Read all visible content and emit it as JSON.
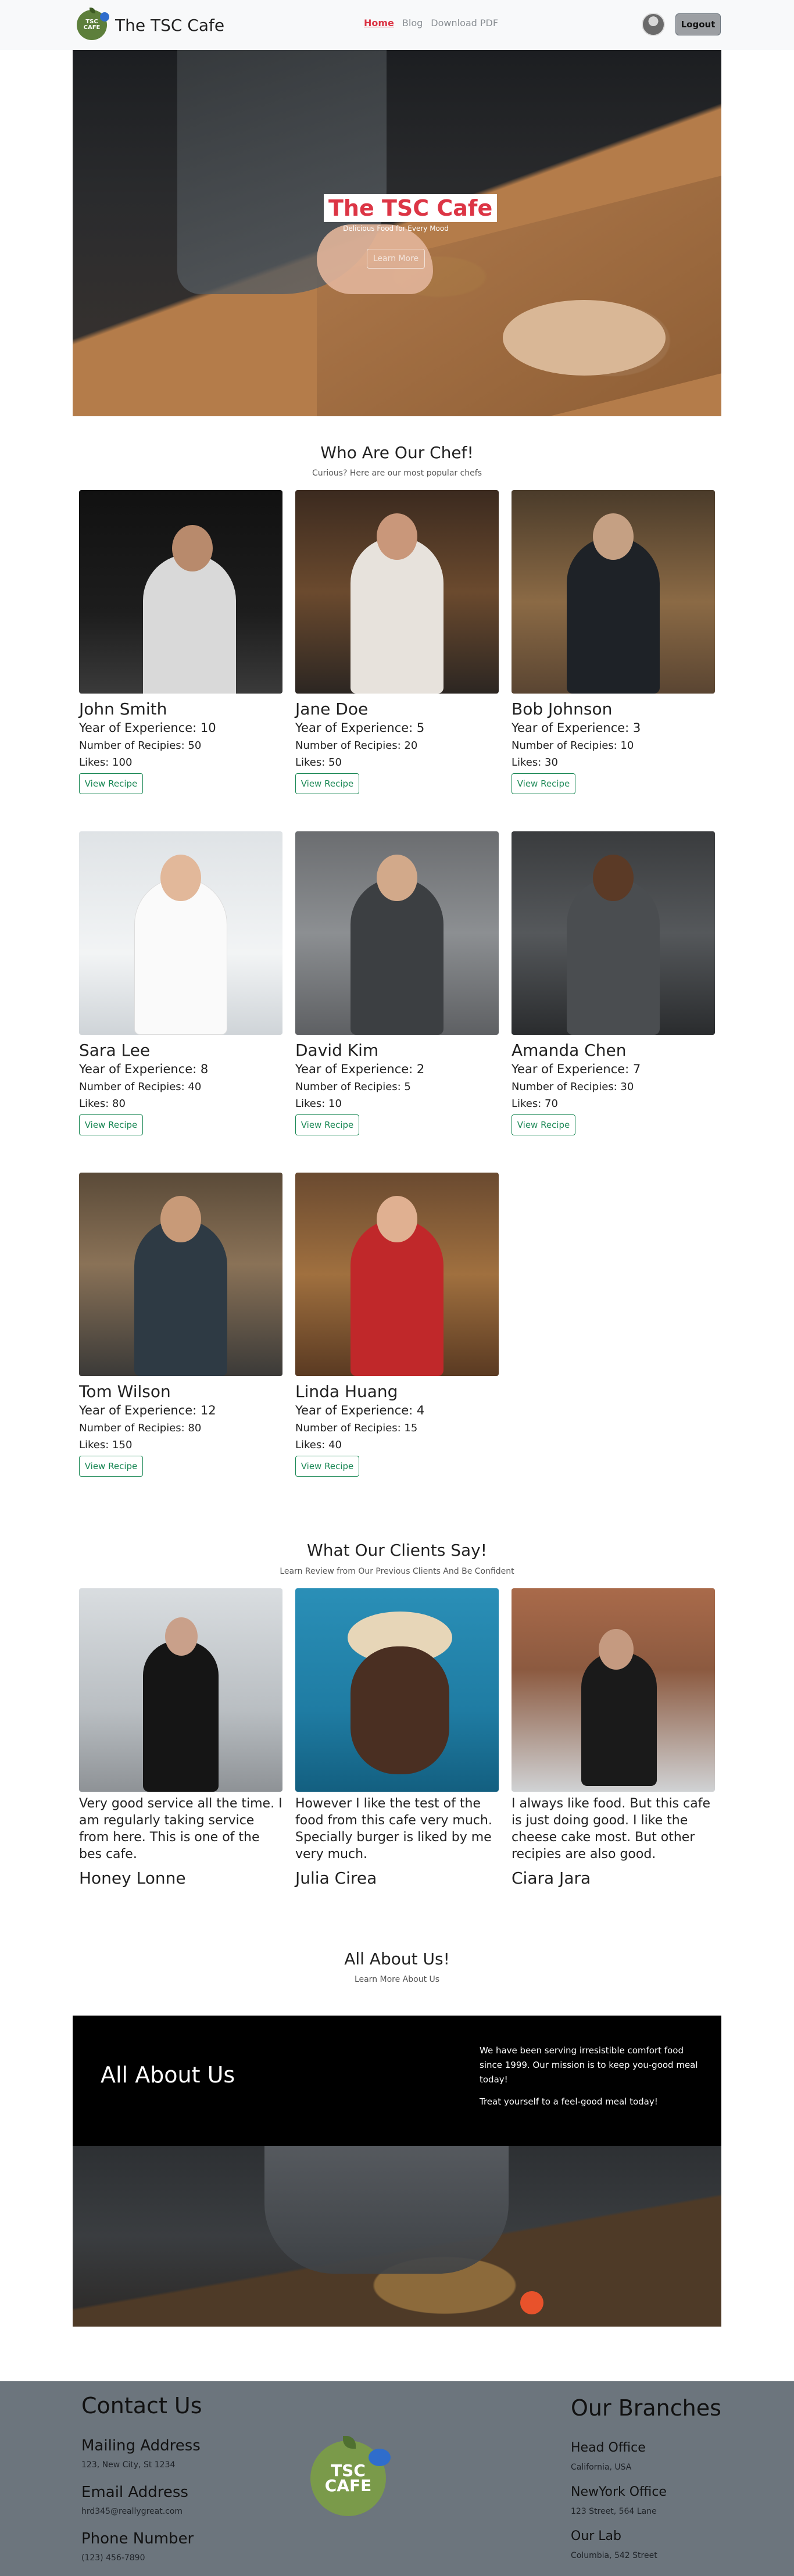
{
  "navbar": {
    "brand": "The TSC Cafe",
    "logo_text": "TSC CAFE",
    "links": [
      "Home",
      "Blog",
      "Download PDF"
    ],
    "logout": "Logout"
  },
  "hero": {
    "title": "The TSC Cafe",
    "subtitle": "Delicious Food for Every Mood",
    "button": "Learn More"
  },
  "chefs_section": {
    "title": "Who Are Our Chef!",
    "subtitle": "Curious? Here are our most popular chefs"
  },
  "chefs": [
    {
      "name": "John Smith",
      "experience": "Year of Experience: 10",
      "recipes": "Number of Recipies: 50",
      "likes": "Likes: 100",
      "button": "View Recipe"
    },
    {
      "name": "Jane Doe",
      "experience": "Year of Experience: 5",
      "recipes": "Number of Recipies: 20",
      "likes": "Likes: 50",
      "button": "View Recipe"
    },
    {
      "name": "Bob Johnson",
      "experience": "Year of Experience: 3",
      "recipes": "Number of Recipies: 10",
      "likes": "Likes: 30",
      "button": "View Recipe"
    },
    {
      "name": "Sara Lee",
      "experience": "Year of Experience: 8",
      "recipes": "Number of Recipies: 40",
      "likes": "Likes: 80",
      "button": "View Recipe"
    },
    {
      "name": "David Kim",
      "experience": "Year of Experience: 2",
      "recipes": "Number of Recipies: 5",
      "likes": "Likes: 10",
      "button": "View Recipe"
    },
    {
      "name": "Amanda Chen",
      "experience": "Year of Experience: 7",
      "recipes": "Number of Recipies: 30",
      "likes": "Likes: 70",
      "button": "View Recipe"
    },
    {
      "name": "Tom Wilson",
      "experience": "Year of Experience: 12",
      "recipes": "Number of Recipies: 80",
      "likes": "Likes: 150",
      "button": "View Recipe"
    },
    {
      "name": "Linda Huang",
      "experience": "Year of Experience: 4",
      "recipes": "Number of Recipies: 15",
      "likes": "Likes: 40",
      "button": "View Recipe"
    }
  ],
  "clients_section": {
    "title": "What Our Clients Say!",
    "subtitle": "Learn Review from Our Previous Clients And Be Confident"
  },
  "clients": [
    {
      "review": "Very good service all the time. I am regularly taking service from here. This is one of the bes cafe.",
      "name": "Honey Lonne"
    },
    {
      "review": "However I like the test of the food from this cafe very much. Specially burger is liked by me very much.",
      "name": "Julia Cirea"
    },
    {
      "review": "I always like food. But this cafe is just doing good. I like the cheese cake most. But other recipies are also good.",
      "name": "Ciara Jara"
    }
  ],
  "about_section": {
    "title": "All About Us!",
    "subtitle": "Learn More About Us",
    "heading": "All About Us",
    "paragraph1": "We have been serving irresistible comfort food since 1999. Our mission is to keep you-good meal today!",
    "paragraph2": "Treat yourself to a feel-good meal today!"
  },
  "footer": {
    "contact_title": "Contact Us",
    "contact": [
      {
        "label": "Mailing Address",
        "value": "123, New City, St 1234"
      },
      {
        "label": "Email Address",
        "value": "hrd345@reallygreat.com"
      },
      {
        "label": "Phone Number",
        "value": "(123) 456-7890"
      }
    ],
    "branches_title": "Our Branches",
    "branches": [
      {
        "label": "Head Office",
        "value": "California, USA"
      },
      {
        "label": "NewYork Office",
        "value": "123 Street, 564 Lane"
      },
      {
        "label": "Our Lab",
        "value": "Columbia, 542 Street"
      }
    ],
    "logo_text": "TSC CAFE"
  },
  "colors": {
    "accent_red": "#dc3545",
    "button_green": "#198754",
    "footer_gray": "#6c757d",
    "navbar_bg": "#f8f9fa"
  },
  "icons": [
    "tsc-cafe-logo-icon",
    "user-avatar-icon"
  ]
}
